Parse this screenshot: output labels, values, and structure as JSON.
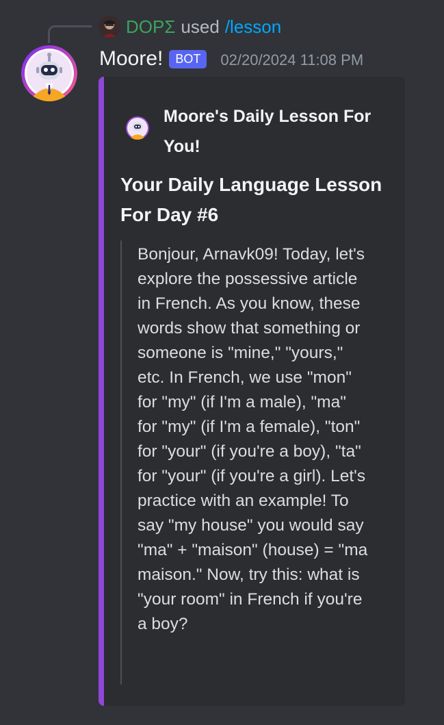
{
  "reply": {
    "user": "DOPΣ",
    "used_text": "used",
    "command": "/lesson"
  },
  "message": {
    "username": "Moore!",
    "bot_tag": "BOT",
    "timestamp": "02/20/2024 11:08 PM"
  },
  "embed": {
    "accent_color": "#8f47d9",
    "author_name": "Moore's Daily Lesson For You!",
    "title": "Your Daily Language Lesson For Day #6",
    "body": "Bonjour, Arnavk09! Today, let's explore the possessive article in French. As you know, these words show that something or someone is \"mine,\" \"yours,\" etc. In French, we use \"mon\" for \"my\" (if I'm a male), \"ma\" for \"my\" (if I'm a female), \"ton\" for \"your\" (if you're a boy), \"ta\" for \"your\" (if you're a girl). Let's practice with an example! To say \"my house\" you would say \"ma\" + \"maison\" (house) = \"ma maison.\" Now, try this: what is \"your room\" in French if you're a boy?"
  },
  "icons": {
    "reply_avatar": "user-avatar-icon",
    "bot_avatar": "robot-avatar-icon",
    "author_icon": "robot-avatar-icon"
  }
}
